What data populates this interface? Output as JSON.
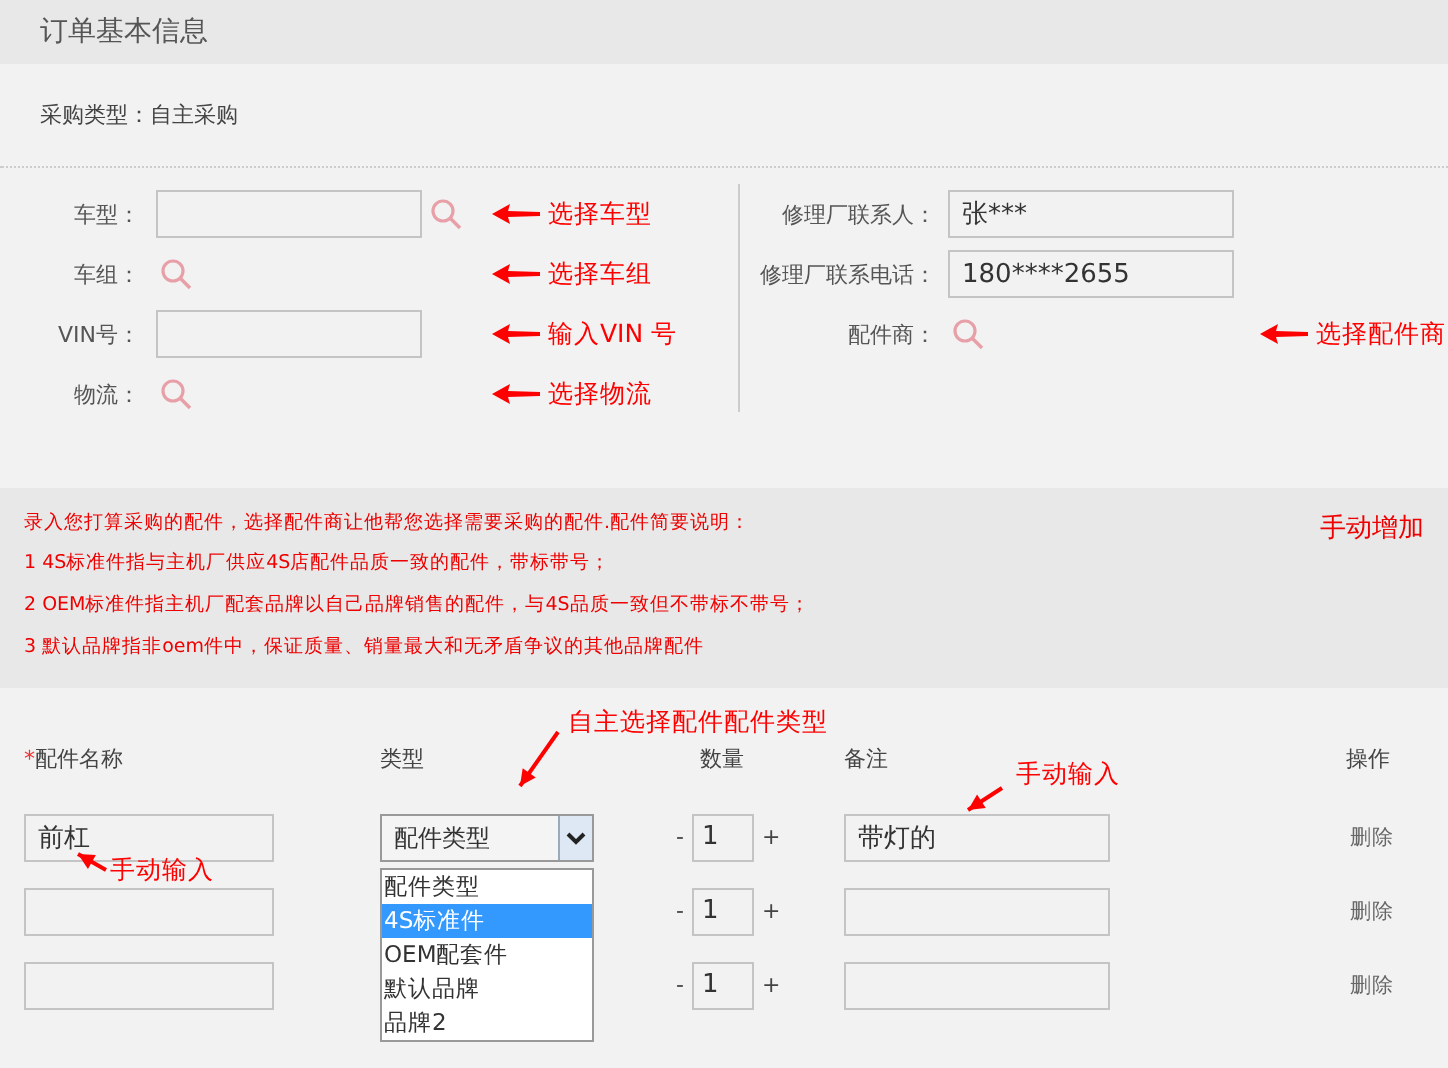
{
  "header": {
    "title": "订单基本信息"
  },
  "purchase_type": "采购类型：自主采购",
  "vehicle_fields": [
    {
      "label": "车型：",
      "kind": "input_search",
      "annotation": "选择车型"
    },
    {
      "label": "车组：",
      "kind": "search",
      "annotation": "选择车组"
    },
    {
      "label": "VIN号：",
      "kind": "input",
      "annotation": "输入VIN 号"
    },
    {
      "label": "物流：",
      "kind": "search",
      "annotation": "选择物流"
    }
  ],
  "contact_fields": [
    {
      "label": "修理厂联系人：",
      "kind": "input",
      "value": "张***"
    },
    {
      "label": "修理厂联系电话：",
      "kind": "input",
      "value": "180****2655"
    },
    {
      "label": "配件商：",
      "kind": "search",
      "annotation": "选择配件商"
    }
  ],
  "notice": {
    "intro": "录入您打算采购的配件，选择配件商让他帮您选择需要采购的配件.配件简要说明：",
    "items": [
      "1  4S标准件指与主机厂供应4S店配件品质一致的配件，带标带号；",
      "2  OEM标准件指主机厂配套品牌以自己品牌销售的配件，与4S品质一致但不带标不带号；",
      "3  默认品牌指非oem件中，保证质量、销量最大和无矛盾争议的其他品牌配件"
    ],
    "add_button": "手动增加"
  },
  "parts_table": {
    "columns": [
      {
        "label": "配件名称",
        "required_mark": "*"
      },
      {
        "label": "类型"
      },
      {
        "label": "数量"
      },
      {
        "label": "备注"
      },
      {
        "label": "操作"
      }
    ],
    "rows": [
      {
        "name": "前杠",
        "type": "配件类型",
        "minus": "-",
        "quantity": "1",
        "plus": "+",
        "remark": "带灯的",
        "action": "删除"
      },
      {
        "minus": "-",
        "quantity": "1",
        "plus": "+",
        "action": "删除"
      },
      {
        "minus": "-",
        "quantity": "1",
        "plus": "+",
        "action": "删除"
      }
    ],
    "type_dropdown": [
      {
        "label": "配件类型",
        "selected": false
      },
      {
        "label": "4S标准件",
        "selected": true
      },
      {
        "label": "OEM配套件",
        "selected": false
      },
      {
        "label": "默认品牌",
        "selected": false
      },
      {
        "label": "品牌2",
        "selected": false
      }
    ],
    "annotations": [
      {
        "kind": "type",
        "text": "自主选择配件配件类型"
      },
      {
        "kind": "remark",
        "text": "手动输入"
      },
      {
        "kind": "name",
        "text": "手动输入"
      }
    ]
  }
}
